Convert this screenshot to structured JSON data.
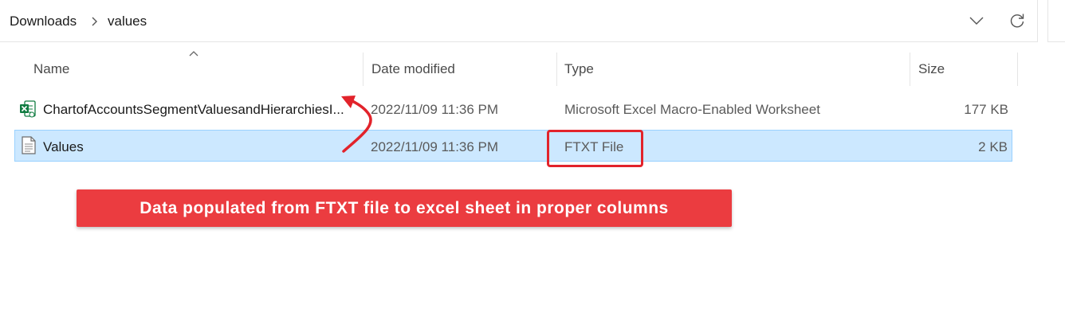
{
  "breadcrumb": {
    "items": [
      "Downloads",
      "values"
    ]
  },
  "columns": {
    "name": "Name",
    "date_modified": "Date modified",
    "type": "Type",
    "size": "Size"
  },
  "files": [
    {
      "name": "ChartofAccountsSegmentValuesandHierarchiesI...",
      "date": "2022/11/09 11:36 PM",
      "type": "Microsoft Excel Macro-Enabled Worksheet",
      "size": "177 KB",
      "icon": "excel-file-icon",
      "selected": false
    },
    {
      "name": "Values",
      "date": "2022/11/09 11:36 PM",
      "type": "FTXT File",
      "size": "2 KB",
      "icon": "text-file-icon",
      "selected": true
    }
  ],
  "annotation": {
    "banner_text": "Data populated from FTXT file to excel sheet in proper columns",
    "color": "#e2232b"
  },
  "colors": {
    "selection_bg": "#cce8ff",
    "selection_border": "#99d1ff",
    "excel_green": "#107c41",
    "banner_bg": "#eb3c40"
  }
}
